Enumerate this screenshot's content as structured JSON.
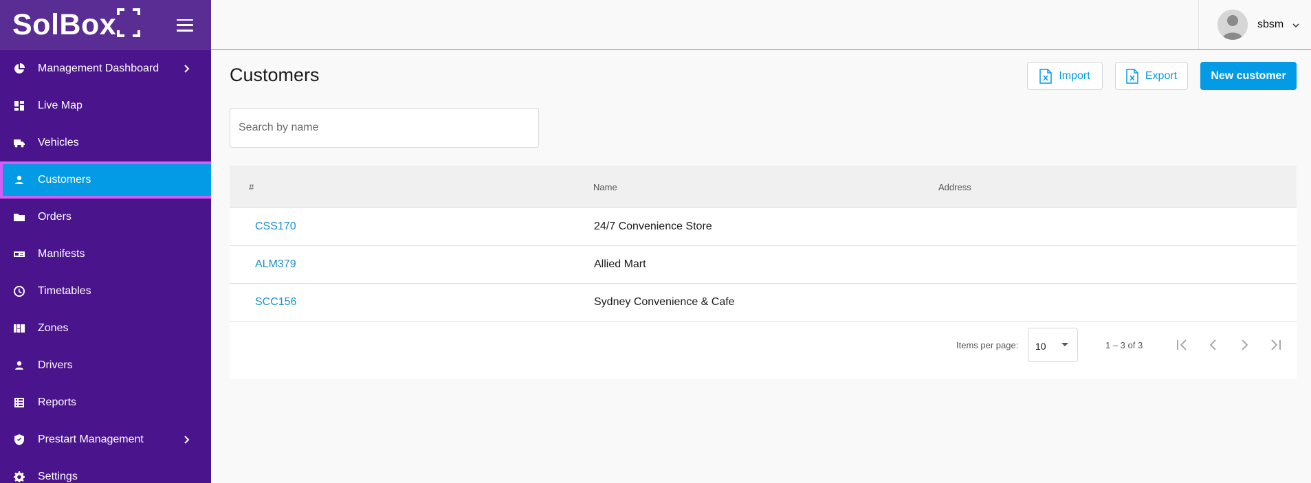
{
  "brand": {
    "name": "SolBox"
  },
  "sidebar": {
    "items": [
      {
        "label": "Management Dashboard",
        "icon": "pie-chart-icon",
        "has_chevron": true
      },
      {
        "label": "Live Map",
        "icon": "dashboard-icon",
        "has_chevron": false
      },
      {
        "label": "Vehicles",
        "icon": "truck-icon",
        "has_chevron": false
      },
      {
        "label": "Customers",
        "icon": "person-icon",
        "has_chevron": false,
        "active": true
      },
      {
        "label": "Orders",
        "icon": "folder-icon",
        "has_chevron": false
      },
      {
        "label": "Manifests",
        "icon": "id-card-icon",
        "has_chevron": false
      },
      {
        "label": "Timetables",
        "icon": "clock-icon",
        "has_chevron": false
      },
      {
        "label": "Zones",
        "icon": "grid-icon",
        "has_chevron": false
      },
      {
        "label": "Drivers",
        "icon": "person-icon",
        "has_chevron": false
      },
      {
        "label": "Reports",
        "icon": "list-icon",
        "has_chevron": false
      },
      {
        "label": "Prestart Management",
        "icon": "shield-check-icon",
        "has_chevron": true
      },
      {
        "label": "Settings",
        "icon": "gear-icon",
        "has_chevron": false
      }
    ]
  },
  "topbar": {
    "user_name": "sbsm"
  },
  "main": {
    "title": "Customers",
    "import_label": "Import",
    "export_label": "Export",
    "new_label": "New customer",
    "search": {
      "placeholder": "Search by name",
      "value": ""
    },
    "table": {
      "columns": [
        "#",
        "Name",
        "Address"
      ],
      "rows": [
        {
          "id": "CSS170",
          "name": "24/7 Convenience Store",
          "address": ""
        },
        {
          "id": "ALM379",
          "name": "Allied Mart",
          "address": ""
        },
        {
          "id": "SCC156",
          "name": "Sydney Convenience & Cafe",
          "address": ""
        }
      ]
    },
    "paginator": {
      "items_per_page_label": "Items per page:",
      "items_per_page": "10",
      "range": "1 – 3 of 3"
    }
  },
  "colors": {
    "sidebar_bg": "#4a148c",
    "brand_bg": "#5a2d94",
    "accent": "#039be5",
    "active_outline": "#d35ef5",
    "link": "#1a8fce"
  }
}
